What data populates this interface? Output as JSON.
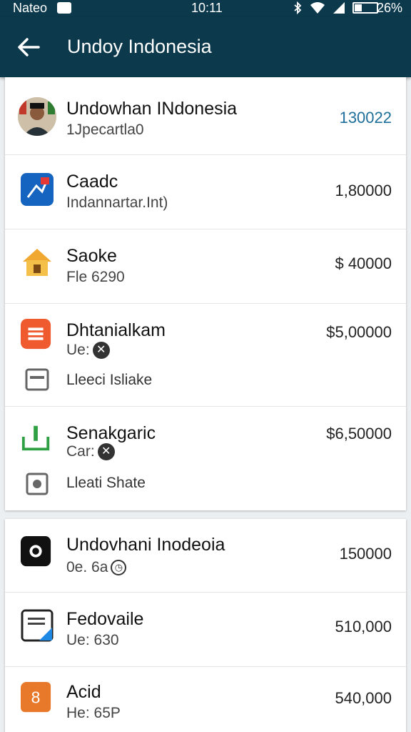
{
  "status_bar": {
    "carrier": "Nateo",
    "time": "10:11",
    "battery_percent": "26%"
  },
  "app_bar": {
    "title": "Undoy Indonesia"
  },
  "list_1": [
    {
      "name": "Undowhan INdonesia",
      "sub": "1Jpecartla0",
      "amount": "130022",
      "amount_color": "#1e6f9a",
      "icon": "avatar"
    },
    {
      "name": "Caadc",
      "sub": "Indannartar.Int)",
      "amount": "1,80000",
      "icon": "app-icon-blue"
    },
    {
      "name": "Saoke",
      "sub": "Fle 6290",
      "amount": "$ 40000",
      "icon": "house-icon"
    },
    {
      "name": "Dhtanialkam",
      "sub": "Ue:",
      "amount": "$5,00000",
      "icon": "list-icon-red",
      "action": {
        "label": "Lleeci Isliake",
        "icon": "card-icon"
      }
    },
    {
      "name": "Senakgaric",
      "sub": "Car:",
      "amount": "$6,50000",
      "icon": "download-icon-green",
      "action": {
        "label": "Lleati Shate",
        "icon": "share-box-icon"
      }
    }
  ],
  "list_2": [
    {
      "name": "Undovhani Inodeoia",
      "sub": "0e. 6a",
      "amount": "150000",
      "icon": "camera-icon"
    },
    {
      "name": "Fedovaile",
      "sub": "Ue: 630",
      "amount": "510,000",
      "icon": "document-icon"
    },
    {
      "name": "Acid",
      "sub": "He: 65P",
      "amount": "540,000",
      "icon": "number-icon-orange"
    }
  ],
  "colors": {
    "header_bg": "#0c3a4c",
    "accent_blue": "#1e6f9a"
  }
}
